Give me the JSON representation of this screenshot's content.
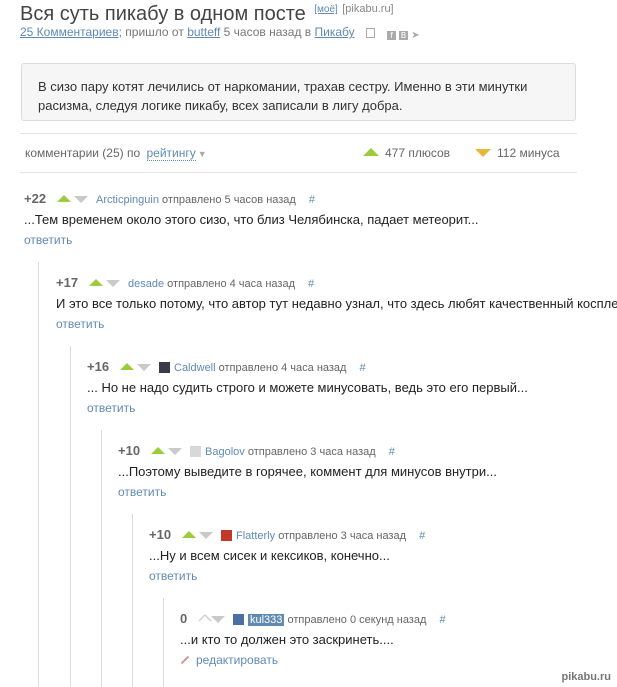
{
  "post": {
    "title": "Вся суть пикабу в одном посте",
    "tag": "[моё]",
    "site": "[pikabu.ru]",
    "comments_link": "25 Комментариев",
    "sent_text": "; пришло от",
    "author": "butteff",
    "time_text": "5 часов назад в",
    "community": "Пикабу",
    "body": "В сизо пару котят лечились от наркомании, трахав сестру. Именно в эти минутки расизма, следуя логике пикабу, всех записали в лигу добра."
  },
  "comments_bar": {
    "label": "комментарии (25) по",
    "sort": "рейтингу",
    "pluses": "477 плюсов",
    "minuses": "112 минуса"
  },
  "comments": [
    {
      "rating": "+22",
      "user": "Arcticpinguin",
      "time": "отправлено 5 часов назад",
      "hash": "#",
      "text": "...Тем временем около этого сизо, что близ Челябинска, падает метеорит...",
      "action": "ответить"
    },
    {
      "rating": "+17",
      "user": "desade",
      "time": "отправлено 4 часа назад",
      "hash": "#",
      "text": "И это все только потому, что автор тут недавно узнал, что здесь любят качественный косплей",
      "action": "ответить"
    },
    {
      "rating": "+16",
      "user": "Caldwell",
      "time": "отправлено 4 часа назад",
      "hash": "#",
      "text": "... Но не надо судить строго и можете минусовать, ведь это его первый...",
      "action": "ответить"
    },
    {
      "rating": "+10",
      "user": "Bagolov",
      "time": "отправлено 3 часа назад",
      "hash": "#",
      "text": "...Поэтому выведите в горячее, коммент для минусов внутри...",
      "action": "ответить"
    },
    {
      "rating": "+10",
      "user": "Flatterly",
      "time": "отправлено 3 часа назад",
      "hash": "#",
      "text": "...Ну и всем сисек и кексиков, конечно...",
      "action": "ответить"
    },
    {
      "rating": "0",
      "user": "kul333",
      "time": "отправлено 0 секунд назад",
      "hash": "#",
      "text": "...и кто то должен это заскринеть....",
      "action": "редактировать"
    }
  ],
  "watermark": "pikabu.ru",
  "colors": {
    "link": "#5f8ab4",
    "plus": "#9ccb3c",
    "minus": "#e8b73a",
    "box_bg": "#f6f6f6"
  }
}
